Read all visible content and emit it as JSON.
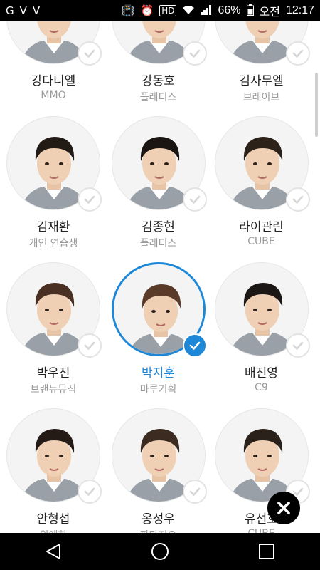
{
  "status_bar": {
    "left_icons": [
      "G",
      "V",
      "V"
    ],
    "battery_percent": "66%",
    "period": "오전",
    "time": "12:17"
  },
  "trainees": [
    {
      "name": "강다니엘",
      "agency": "MMO",
      "selected": false
    },
    {
      "name": "강동호",
      "agency": "플레디스",
      "selected": false
    },
    {
      "name": "김사무엘",
      "agency": "브레이브",
      "selected": false
    },
    {
      "name": "김재환",
      "agency": "개인 연습생",
      "selected": false
    },
    {
      "name": "김종현",
      "agency": "플레디스",
      "selected": false
    },
    {
      "name": "라이관린",
      "agency": "CUBE",
      "selected": false
    },
    {
      "name": "박우진",
      "agency": "브랜뉴뮤직",
      "selected": false
    },
    {
      "name": "박지훈",
      "agency": "마루기획",
      "selected": true
    },
    {
      "name": "배진영",
      "agency": "C9",
      "selected": false
    },
    {
      "name": "안형섭",
      "agency": "위에화",
      "selected": false
    },
    {
      "name": "옹성우",
      "agency": "판타지오",
      "selected": false
    },
    {
      "name": "유선호",
      "agency": "CUBE",
      "selected": false
    }
  ],
  "colors": {
    "accent": "#1e88d8",
    "check_idle": "#d6d6d6",
    "name_text": "#222222",
    "agency_text": "#9a9a9a"
  },
  "icons": {
    "close": "close-icon",
    "back": "back-triangle-icon",
    "home": "home-circle-icon",
    "recents": "recents-square-icon"
  }
}
